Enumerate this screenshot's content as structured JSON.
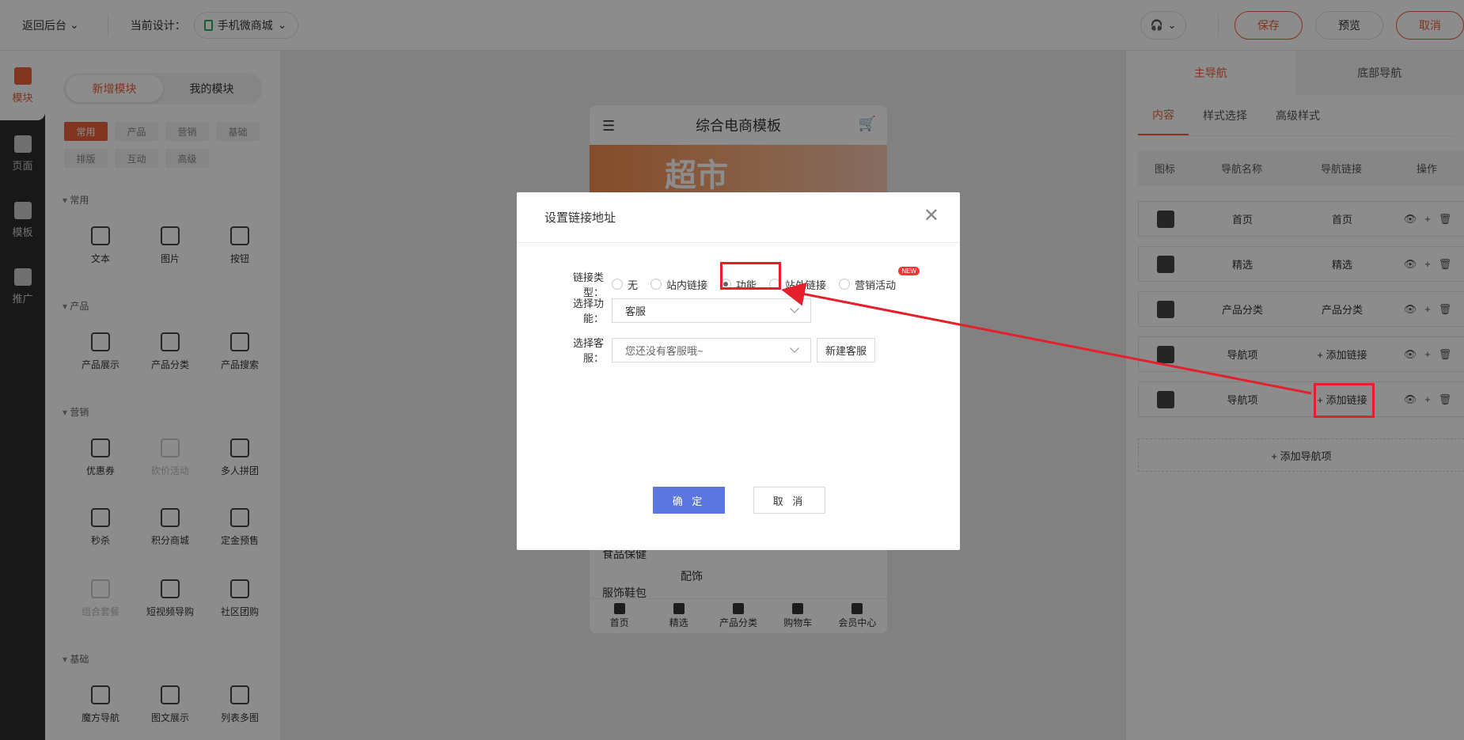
{
  "topbar": {
    "back": "返回后台",
    "current_label": "当前设计：",
    "design_name": "手机微商城",
    "save": "保存",
    "preview": "预览",
    "cancel": "取消"
  },
  "rail": [
    {
      "label": "模块",
      "icon": "cube-icon",
      "active": true
    },
    {
      "label": "页面",
      "icon": "page-icon"
    },
    {
      "label": "模板",
      "icon": "template-icon"
    },
    {
      "label": "推广",
      "icon": "megaphone-icon"
    }
  ],
  "module_panel": {
    "seg_new": "新增模块",
    "seg_mine": "我的模块",
    "chips": [
      "常用",
      "产品",
      "营销",
      "基础",
      "排版",
      "互动",
      "高级"
    ],
    "sections": {
      "common": "常用",
      "product": "产品",
      "marketing": "营销",
      "basic": "基础"
    },
    "modules": {
      "text": "文本",
      "image": "图片",
      "button": "按钮",
      "prod_show": "产品展示",
      "prod_cat": "产品分类",
      "prod_search": "产品搜索",
      "coupon": "优惠券",
      "bargain": "砍价活动",
      "group": "多人拼团",
      "seckill": "秒杀",
      "points": "积分商城",
      "deposit": "定金预售",
      "combo": "组合套餐",
      "video": "短视频导购",
      "community": "社区团购",
      "magic_nav": "魔方导航",
      "pic_text": "图文展示",
      "list_multi": "列表多图"
    }
  },
  "phone": {
    "title": "综合电商模板",
    "banner": "超市",
    "side1": "食品保健",
    "side2": "配饰",
    "side3": "服饰鞋包",
    "tabs": [
      "首页",
      "精选",
      "产品分类",
      "购物车",
      "会员中心"
    ]
  },
  "config": {
    "tab_main": "主导航",
    "tab_bottom": "底部导航",
    "sub_content": "内容",
    "sub_style": "样式选择",
    "sub_adv": "高级样式",
    "headers": [
      "图标",
      "导航名称",
      "导航链接",
      "操作"
    ],
    "rows": [
      {
        "name": "首页",
        "link": "首页",
        "icon": "store-icon"
      },
      {
        "name": "精选",
        "link": "精选",
        "icon": "gift-icon"
      },
      {
        "name": "产品分类",
        "link": "产品分类",
        "icon": "grid-icon"
      },
      {
        "name": "导航项",
        "link": "+ 添加链接",
        "icon": "gear-icon"
      },
      {
        "name": "导航项",
        "link": "+ 添加链接",
        "icon": "gear-icon"
      }
    ],
    "add_nav": "+ 添加导航项"
  },
  "modal": {
    "title": "设置链接地址",
    "type_label": "链接类型：",
    "types": [
      "无",
      "站内链接",
      "功能",
      "站外链接",
      "营销活动"
    ],
    "selected_type": "功能",
    "new_badge": "NEW",
    "func_label": "选择功能：",
    "func_value": "客服",
    "cs_label": "选择客服：",
    "cs_placeholder": "您还没有客服哦~",
    "new_cs": "新建客服",
    "ok": "确 定",
    "cancel": "取 消"
  },
  "colors": {
    "accent": "#e9623b",
    "primary_btn": "#5b76e0",
    "annotation": "#e5202a"
  }
}
